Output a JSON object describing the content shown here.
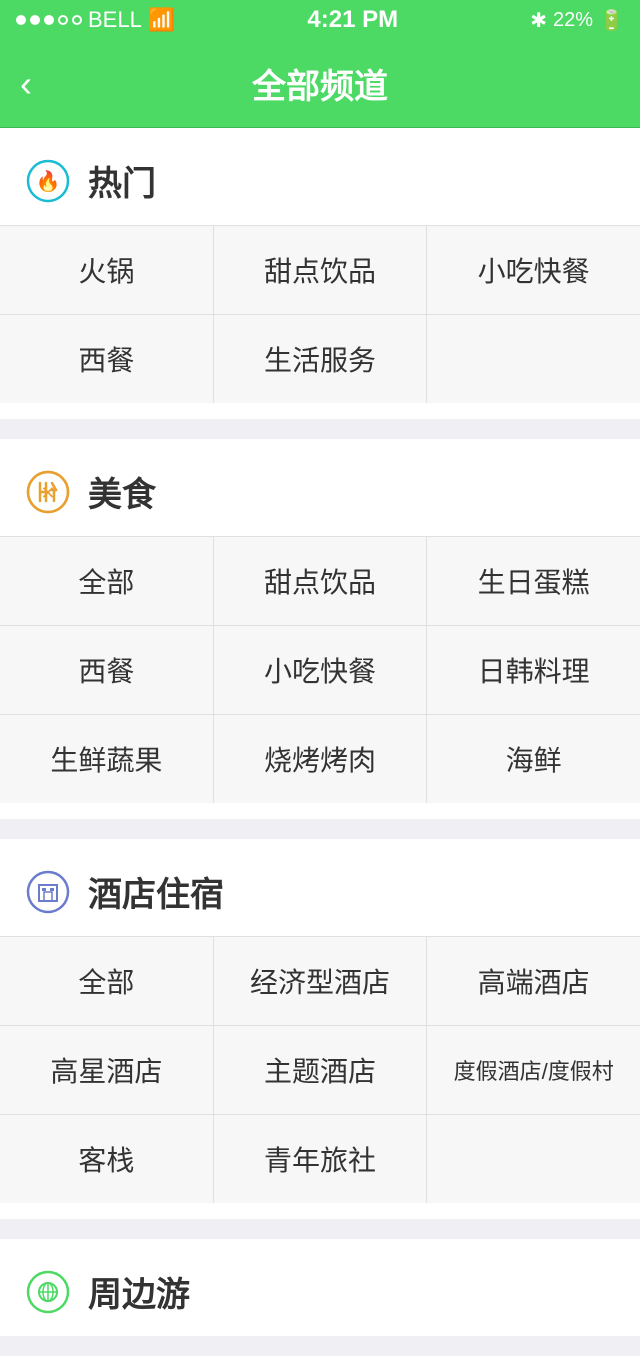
{
  "statusBar": {
    "carrier": "BELL",
    "time": "4:21 PM",
    "battery": "22%"
  },
  "header": {
    "back_label": "‹",
    "title": "全部频道"
  },
  "sections": [
    {
      "id": "hot",
      "icon": "fire",
      "title": "热门",
      "items": [
        [
          "火锅",
          "甜点饮品",
          "小吃快餐"
        ],
        [
          "西餐",
          "生活服务",
          ""
        ]
      ]
    },
    {
      "id": "food",
      "icon": "fork-knife",
      "title": "美食",
      "items": [
        [
          "全部",
          "甜点饮品",
          "生日蛋糕"
        ],
        [
          "西餐",
          "小吃快餐",
          "日韩料理"
        ],
        [
          "生鲜蔬果",
          "烧烤烤肉",
          "海鲜"
        ]
      ]
    },
    {
      "id": "hotel",
      "icon": "hotel",
      "title": "酒店住宿",
      "items": [
        [
          "全部",
          "经济型酒店",
          "高端酒店"
        ],
        [
          "高星酒店",
          "主题酒店",
          "度假酒店/度假村"
        ],
        [
          "客栈",
          "青年旅社",
          ""
        ]
      ]
    },
    {
      "id": "travel",
      "icon": "travel",
      "title": "周边游",
      "items": []
    }
  ]
}
